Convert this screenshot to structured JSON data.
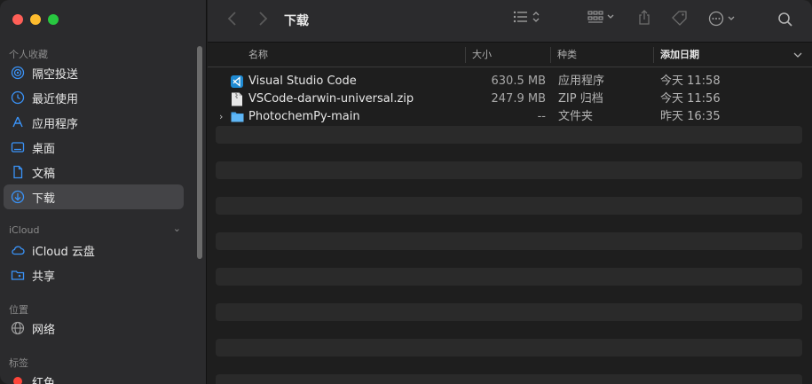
{
  "toolbar": {
    "title": "下载",
    "back_icon": "chevron-left-icon",
    "forward_icon": "chevron-right-icon"
  },
  "sidebar": {
    "favorites_label": "个人收藏",
    "icloud_label": "iCloud",
    "locations_label": "位置",
    "tags_label": "标签",
    "items": [
      {
        "label": "隔空投送",
        "icon": "airdrop-icon"
      },
      {
        "label": "最近使用",
        "icon": "clock-icon"
      },
      {
        "label": "应用程序",
        "icon": "applications-icon"
      },
      {
        "label": "桌面",
        "icon": "desktop-icon"
      },
      {
        "label": "文稿",
        "icon": "document-icon"
      },
      {
        "label": "下载",
        "icon": "download-icon"
      },
      {
        "label": "iCloud 云盘",
        "icon": "cloud-icon"
      },
      {
        "label": "共享",
        "icon": "shared-folder-icon"
      },
      {
        "label": "网络",
        "icon": "globe-icon"
      },
      {
        "label": "红色",
        "icon": "red-tag-dot"
      }
    ]
  },
  "columns": {
    "name": "名称",
    "size": "大小",
    "kind": "种类",
    "date": "添加日期"
  },
  "files": [
    {
      "name": "Visual Studio Code",
      "size": "630.5 MB",
      "kind": "应用程序",
      "date": "今天 11:58",
      "icon": "vscode-app-icon"
    },
    {
      "name": "VSCode-darwin-universal.zip",
      "size": "247.9 MB",
      "kind": "ZIP 归档",
      "date": "今天 11:56",
      "icon": "zip-file-icon"
    },
    {
      "name": "PhotochemPy-main",
      "size": "--",
      "kind": "文件夹",
      "date": "昨天 16:35",
      "icon": "folder-icon"
    }
  ],
  "colors": {
    "accent": "#3a93f8",
    "sidebar_bg": "#2b2b2d",
    "content_bg": "#1e1e1e",
    "stripe": "#2a2a2a"
  }
}
